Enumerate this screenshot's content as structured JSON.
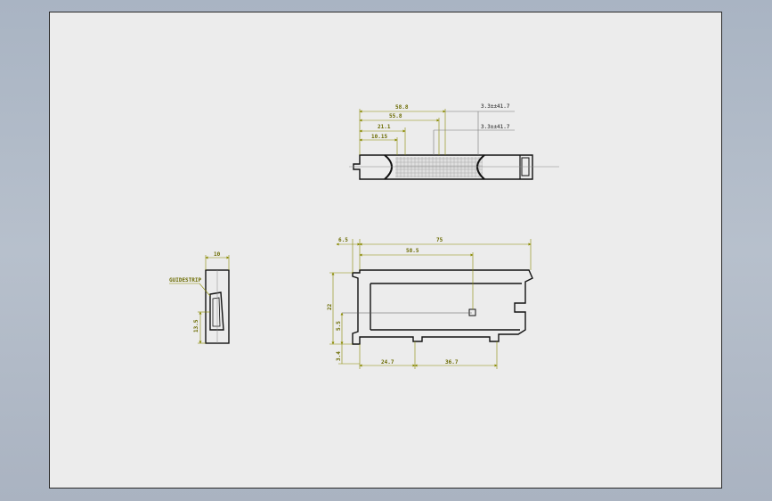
{
  "colors": {
    "background": "#aab3c1",
    "sheet": "#ececec",
    "outline": "#111111",
    "dimension": "#8a8a00",
    "leader": "#777777"
  },
  "top_view": {
    "dims": {
      "d1": "58.8",
      "d2": "55.8",
      "d3": "21.1",
      "d4": "10.15",
      "tol1": "3.3±±41.7",
      "tol2": "3.3±±41.7"
    }
  },
  "side_view": {
    "dims": {
      "width": "10",
      "note": "GUIDESTRIP",
      "height": "13.5"
    }
  },
  "front_view": {
    "dims": {
      "left_offset": "6.5",
      "overall_length": "75",
      "hole_x": "58.5",
      "overall_height": "22",
      "hole_y": "5.5",
      "foot": "3.4",
      "step1": "24.7",
      "step2": "36.7"
    }
  }
}
